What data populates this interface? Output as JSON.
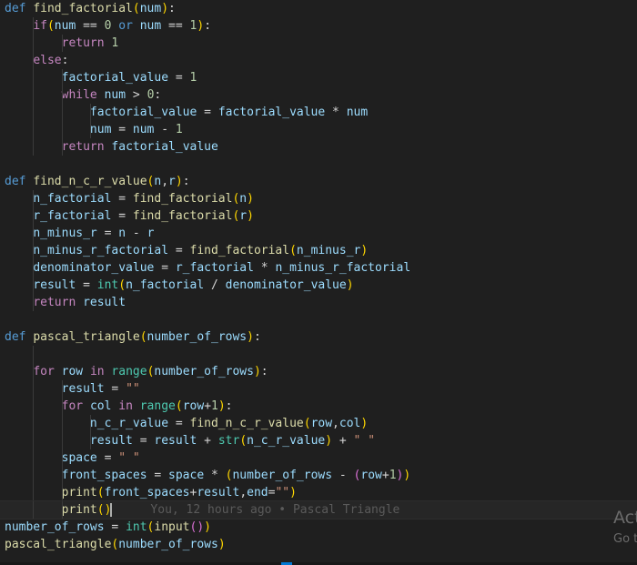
{
  "editor": {
    "lines": [
      [
        [
          "kw",
          "def"
        ],
        [
          "op",
          " "
        ],
        [
          "fn",
          "find_factorial"
        ],
        [
          "p1",
          "("
        ],
        [
          "var",
          "num"
        ],
        [
          "p1",
          ")"
        ],
        [
          "op",
          ":"
        ]
      ],
      [
        [
          "op",
          "    "
        ],
        [
          "ctl",
          "if"
        ],
        [
          "p1",
          "("
        ],
        [
          "var",
          "num"
        ],
        [
          "op",
          " == "
        ],
        [
          "num",
          "0"
        ],
        [
          "op",
          " "
        ],
        [
          "kw",
          "or"
        ],
        [
          "op",
          " "
        ],
        [
          "var",
          "num"
        ],
        [
          "op",
          " == "
        ],
        [
          "num",
          "1"
        ],
        [
          "p1",
          ")"
        ],
        [
          "op",
          ":"
        ]
      ],
      [
        [
          "op",
          "        "
        ],
        [
          "ctl",
          "return"
        ],
        [
          "op",
          " "
        ],
        [
          "num",
          "1"
        ]
      ],
      [
        [
          "op",
          "    "
        ],
        [
          "ctl",
          "else"
        ],
        [
          "op",
          ":"
        ]
      ],
      [
        [
          "op",
          "        "
        ],
        [
          "var",
          "factorial_value"
        ],
        [
          "op",
          " = "
        ],
        [
          "num",
          "1"
        ]
      ],
      [
        [
          "op",
          "        "
        ],
        [
          "ctl",
          "while"
        ],
        [
          "op",
          " "
        ],
        [
          "var",
          "num"
        ],
        [
          "op",
          " > "
        ],
        [
          "num",
          "0"
        ],
        [
          "op",
          ":"
        ]
      ],
      [
        [
          "op",
          "            "
        ],
        [
          "var",
          "factorial_value"
        ],
        [
          "op",
          " = "
        ],
        [
          "var",
          "factorial_value"
        ],
        [
          "op",
          " * "
        ],
        [
          "var",
          "num"
        ]
      ],
      [
        [
          "op",
          "            "
        ],
        [
          "var",
          "num"
        ],
        [
          "op",
          " = "
        ],
        [
          "var",
          "num"
        ],
        [
          "op",
          " - "
        ],
        [
          "num",
          "1"
        ]
      ],
      [
        [
          "op",
          "        "
        ],
        [
          "ctl",
          "return"
        ],
        [
          "op",
          " "
        ],
        [
          "var",
          "factorial_value"
        ]
      ],
      [],
      [
        [
          "kw",
          "def"
        ],
        [
          "op",
          " "
        ],
        [
          "fn",
          "find_n_c_r_value"
        ],
        [
          "p1",
          "("
        ],
        [
          "var",
          "n"
        ],
        [
          "op",
          ","
        ],
        [
          "var",
          "r"
        ],
        [
          "p1",
          ")"
        ],
        [
          "op",
          ":"
        ]
      ],
      [
        [
          "op",
          "    "
        ],
        [
          "var",
          "n_factorial"
        ],
        [
          "op",
          " = "
        ],
        [
          "fn",
          "find_factorial"
        ],
        [
          "p1",
          "("
        ],
        [
          "var",
          "n"
        ],
        [
          "p1",
          ")"
        ]
      ],
      [
        [
          "op",
          "    "
        ],
        [
          "var",
          "r_factorial"
        ],
        [
          "op",
          " = "
        ],
        [
          "fn",
          "find_factorial"
        ],
        [
          "p1",
          "("
        ],
        [
          "var",
          "r"
        ],
        [
          "p1",
          ")"
        ]
      ],
      [
        [
          "op",
          "    "
        ],
        [
          "var",
          "n_minus_r"
        ],
        [
          "op",
          " = "
        ],
        [
          "var",
          "n"
        ],
        [
          "op",
          " - "
        ],
        [
          "var",
          "r"
        ]
      ],
      [
        [
          "op",
          "    "
        ],
        [
          "var",
          "n_minus_r_factorial"
        ],
        [
          "op",
          " = "
        ],
        [
          "fn",
          "find_factorial"
        ],
        [
          "p1",
          "("
        ],
        [
          "var",
          "n_minus_r"
        ],
        [
          "p1",
          ")"
        ]
      ],
      [
        [
          "op",
          "    "
        ],
        [
          "var",
          "denominator_value"
        ],
        [
          "op",
          " = "
        ],
        [
          "var",
          "r_factorial"
        ],
        [
          "op",
          " * "
        ],
        [
          "var",
          "n_minus_r_factorial"
        ]
      ],
      [
        [
          "op",
          "    "
        ],
        [
          "var",
          "result"
        ],
        [
          "op",
          " = "
        ],
        [
          "builtin",
          "int"
        ],
        [
          "p1",
          "("
        ],
        [
          "var",
          "n_factorial"
        ],
        [
          "op",
          " / "
        ],
        [
          "var",
          "denominator_value"
        ],
        [
          "p1",
          ")"
        ]
      ],
      [
        [
          "op",
          "    "
        ],
        [
          "ctl",
          "return"
        ],
        [
          "op",
          " "
        ],
        [
          "var",
          "result"
        ]
      ],
      [],
      [
        [
          "kw",
          "def"
        ],
        [
          "op",
          " "
        ],
        [
          "fn",
          "pascal_triangle"
        ],
        [
          "p1",
          "("
        ],
        [
          "var",
          "number_of_rows"
        ],
        [
          "p1",
          ")"
        ],
        [
          "op",
          ":"
        ]
      ],
      [],
      [
        [
          "op",
          "    "
        ],
        [
          "ctl",
          "for"
        ],
        [
          "op",
          " "
        ],
        [
          "var",
          "row"
        ],
        [
          "op",
          " "
        ],
        [
          "ctl",
          "in"
        ],
        [
          "op",
          " "
        ],
        [
          "builtin",
          "range"
        ],
        [
          "p1",
          "("
        ],
        [
          "var",
          "number_of_rows"
        ],
        [
          "p1",
          ")"
        ],
        [
          "op",
          ":"
        ]
      ],
      [
        [
          "op",
          "        "
        ],
        [
          "var",
          "result"
        ],
        [
          "op",
          " = "
        ],
        [
          "str",
          "\"\""
        ]
      ],
      [
        [
          "op",
          "        "
        ],
        [
          "ctl",
          "for"
        ],
        [
          "op",
          " "
        ],
        [
          "var",
          "col"
        ],
        [
          "op",
          " "
        ],
        [
          "ctl",
          "in"
        ],
        [
          "op",
          " "
        ],
        [
          "builtin",
          "range"
        ],
        [
          "p1",
          "("
        ],
        [
          "var",
          "row"
        ],
        [
          "op",
          "+"
        ],
        [
          "num",
          "1"
        ],
        [
          "p1",
          ")"
        ],
        [
          "op",
          ":"
        ]
      ],
      [
        [
          "op",
          "            "
        ],
        [
          "var",
          "n_c_r_value"
        ],
        [
          "op",
          " = "
        ],
        [
          "fn",
          "find_n_c_r_value"
        ],
        [
          "p1",
          "("
        ],
        [
          "var",
          "row"
        ],
        [
          "op",
          ","
        ],
        [
          "var",
          "col"
        ],
        [
          "p1",
          ")"
        ]
      ],
      [
        [
          "op",
          "            "
        ],
        [
          "var",
          "result"
        ],
        [
          "op",
          " = "
        ],
        [
          "var",
          "result"
        ],
        [
          "op",
          " + "
        ],
        [
          "builtin",
          "str"
        ],
        [
          "p1",
          "("
        ],
        [
          "var",
          "n_c_r_value"
        ],
        [
          "p1",
          ")"
        ],
        [
          "op",
          " + "
        ],
        [
          "str",
          "\" \""
        ]
      ],
      [
        [
          "op",
          "        "
        ],
        [
          "var",
          "space"
        ],
        [
          "op",
          " = "
        ],
        [
          "str",
          "\" \""
        ]
      ],
      [
        [
          "op",
          "        "
        ],
        [
          "var",
          "front_spaces"
        ],
        [
          "op",
          " = "
        ],
        [
          "var",
          "space"
        ],
        [
          "op",
          " * "
        ],
        [
          "p1",
          "("
        ],
        [
          "var",
          "number_of_rows"
        ],
        [
          "op",
          " - "
        ],
        [
          "p2",
          "("
        ],
        [
          "var",
          "row"
        ],
        [
          "op",
          "+"
        ],
        [
          "num",
          "1"
        ],
        [
          "p2",
          ")"
        ],
        [
          "p1",
          ")"
        ]
      ],
      [
        [
          "op",
          "        "
        ],
        [
          "fn",
          "print"
        ],
        [
          "p1",
          "("
        ],
        [
          "var",
          "front_spaces"
        ],
        [
          "op",
          "+"
        ],
        [
          "var",
          "result"
        ],
        [
          "op",
          ","
        ],
        [
          "var",
          "end"
        ],
        [
          "op",
          "="
        ],
        [
          "str",
          "\"\""
        ],
        [
          "p1",
          ")"
        ]
      ],
      [
        [
          "op",
          "        "
        ],
        [
          "fn",
          "print"
        ],
        [
          "p1",
          "("
        ],
        [
          "p1",
          ")"
        ]
      ],
      [
        [
          "var",
          "number_of_rows"
        ],
        [
          "op",
          " = "
        ],
        [
          "builtin",
          "int"
        ],
        [
          "p1",
          "("
        ],
        [
          "fn",
          "input"
        ],
        [
          "p2",
          "("
        ],
        [
          "p2",
          ")"
        ],
        [
          "p1",
          ")"
        ]
      ],
      [
        [
          "fn",
          "pascal_triangle"
        ],
        [
          "p1",
          "("
        ],
        [
          "var",
          "number_of_rows"
        ],
        [
          "p1",
          ")"
        ]
      ]
    ],
    "guide_columns": [
      [],
      [
        4
      ],
      [
        4,
        8
      ],
      [
        4
      ],
      [
        4,
        8
      ],
      [
        4,
        8
      ],
      [
        4,
        8,
        12
      ],
      [
        4,
        8,
        12
      ],
      [
        4,
        8
      ],
      [],
      [],
      [
        4
      ],
      [
        4
      ],
      [
        4
      ],
      [
        4
      ],
      [
        4
      ],
      [
        4
      ],
      [
        4
      ],
      [],
      [],
      [
        4
      ],
      [
        4
      ],
      [
        4,
        8
      ],
      [
        4,
        8
      ],
      [
        4,
        8,
        12
      ],
      [
        4,
        8,
        12
      ],
      [
        4,
        8
      ],
      [
        4,
        8
      ],
      [
        4,
        8
      ],
      [
        4,
        8
      ],
      [],
      []
    ],
    "current_line": 29,
    "blame_annotation": "You, 12 hours ago • Pascal Triangle"
  },
  "watermark": {
    "line1": "Act",
    "line2": "Go t"
  },
  "colors": {
    "background": "#1f1f1f",
    "keyword": "#569cd6",
    "control": "#c586c0",
    "function": "#dcdcaa",
    "variable": "#9cdcfe",
    "number": "#b5cea8",
    "string": "#ce9178",
    "builtin": "#4ec9b0",
    "bracket1": "#ffd700",
    "bracket2": "#da70d6",
    "accent": "#0078d4"
  }
}
